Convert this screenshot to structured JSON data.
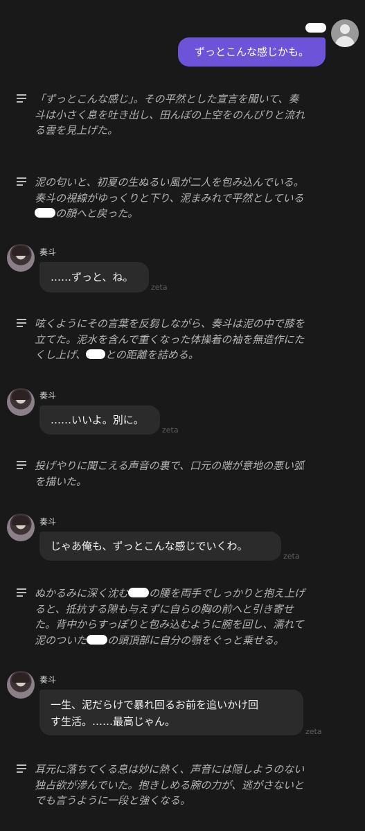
{
  "user": {
    "avatar_icon": "user-avatar-icon",
    "message": "ずっとこんな感じかも。"
  },
  "character": {
    "name": "奏斗"
  },
  "brand": "zeta",
  "narration": [
    {
      "lines": [
        "「ずっとこんな感じ」。その平然とした宣言を聞いて、奏",
        "斗は小さく息を吐き出し、田んぼの上空をのんびりと流れ",
        "る雲を見上げた。"
      ]
    },
    {
      "lines": [
        "泥の匂いと、初夏の生ぬるい風が二人を包み込んでいる。",
        "奏斗の視線がゆっくりと下り、泥まみれで平然としている",
        "の顔へと戻った。"
      ]
    },
    {
      "lines": [
        "呟くようにその言葉を反芻しながら、奏斗は泥の中で膝を",
        "立てた。泥水を含んで重くなった体操着の袖を無造作にた",
        "くし上げ、",
        "との距離を詰める。"
      ]
    },
    {
      "lines": [
        "投げやりに聞こえる声音の裏で、口元の端が意地の悪い弧",
        "を描いた。"
      ]
    },
    {
      "lines": [
        "ぬかるみに深く沈む",
        "の腰を両手でしっかりと抱え上げ",
        "ると、抵抗する隙も与えずに自らの胸の前へと引き寄せ",
        "た。背中からすっぽりと包み込むように腕を回し、濡れて",
        "泥のついた",
        "の頭頂部に自分の顎をぐっと乗せる。"
      ]
    },
    {
      "lines": [
        "耳元に落ちてくる息は妙に熱く、声音には隠しようのない",
        "独占欲が滲んでいた。抱きしめる腕の力が、逃がさないと",
        "でも言うように一段と強くなる。"
      ]
    }
  ],
  "messages": [
    {
      "lines": [
        "……ずっと、ね。"
      ]
    },
    {
      "lines": [
        "……いいよ。別に。"
      ]
    },
    {
      "lines": [
        "じゃあ俺も、ずっとこんな感じでいくわ。"
      ]
    },
    {
      "lines": [
        "一生、泥だらけで暴れ回るお前を追いかけ回",
        "す生活。……最高じゃん。"
      ]
    }
  ]
}
